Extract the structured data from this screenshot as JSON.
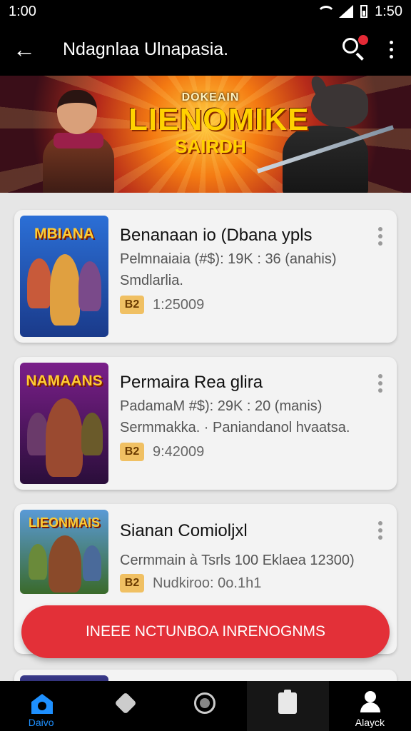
{
  "status_bar": {
    "time_left": "1:00",
    "time_right": "1:50"
  },
  "app_bar": {
    "title": "Ndagnlaa Ulnapasia."
  },
  "banner": {
    "line1": "DOKEAIN",
    "line2": "LIENOMIKE",
    "line3": "SAIRDH"
  },
  "cards": [
    {
      "thumb_title": "MBIANA",
      "title": "Benanaan io (Dbana ypls",
      "line1": "Pelmnaiaia (#$): 19K : 36 (anahis)",
      "line2": "Smdlarlia.",
      "badge": "B2",
      "badge_text": "1:25009",
      "thumb_colors": [
        "#2b6fd6",
        "#1a3a8a"
      ]
    },
    {
      "thumb_title": "NAMAANS",
      "title": "Permaira Rea glira",
      "line1": "PadamaM #$): 29K : 20 (manis)",
      "line2": "Sermmakka. · Paniandanol hvaatsa.",
      "badge": "B2",
      "badge_text": "9:42009",
      "thumb_colors": [
        "#7a1f8a",
        "#2a0e3a"
      ]
    },
    {
      "thumb_title": "LIEONMAIS",
      "title": "Sianan Comioljxl",
      "line1": "Cermmain à Tsrls 100 Eklaea 12300)",
      "line2": "",
      "badge": "B2",
      "badge_text": "Nudkiroo: 0o.1h1",
      "thumb_colors": [
        "#5a9ad6",
        "#3a6a2a"
      ]
    }
  ],
  "cta": {
    "label": "INEEE NCTUNBOA INRENOGNMS"
  },
  "nav": [
    {
      "label": "Daivo",
      "icon": "home-icon"
    },
    {
      "label": "",
      "icon": "tag-icon"
    },
    {
      "label": "",
      "icon": "record-icon"
    },
    {
      "label": "",
      "icon": "clipboard-icon"
    },
    {
      "label": "Alayck",
      "icon": "profile-icon"
    }
  ]
}
